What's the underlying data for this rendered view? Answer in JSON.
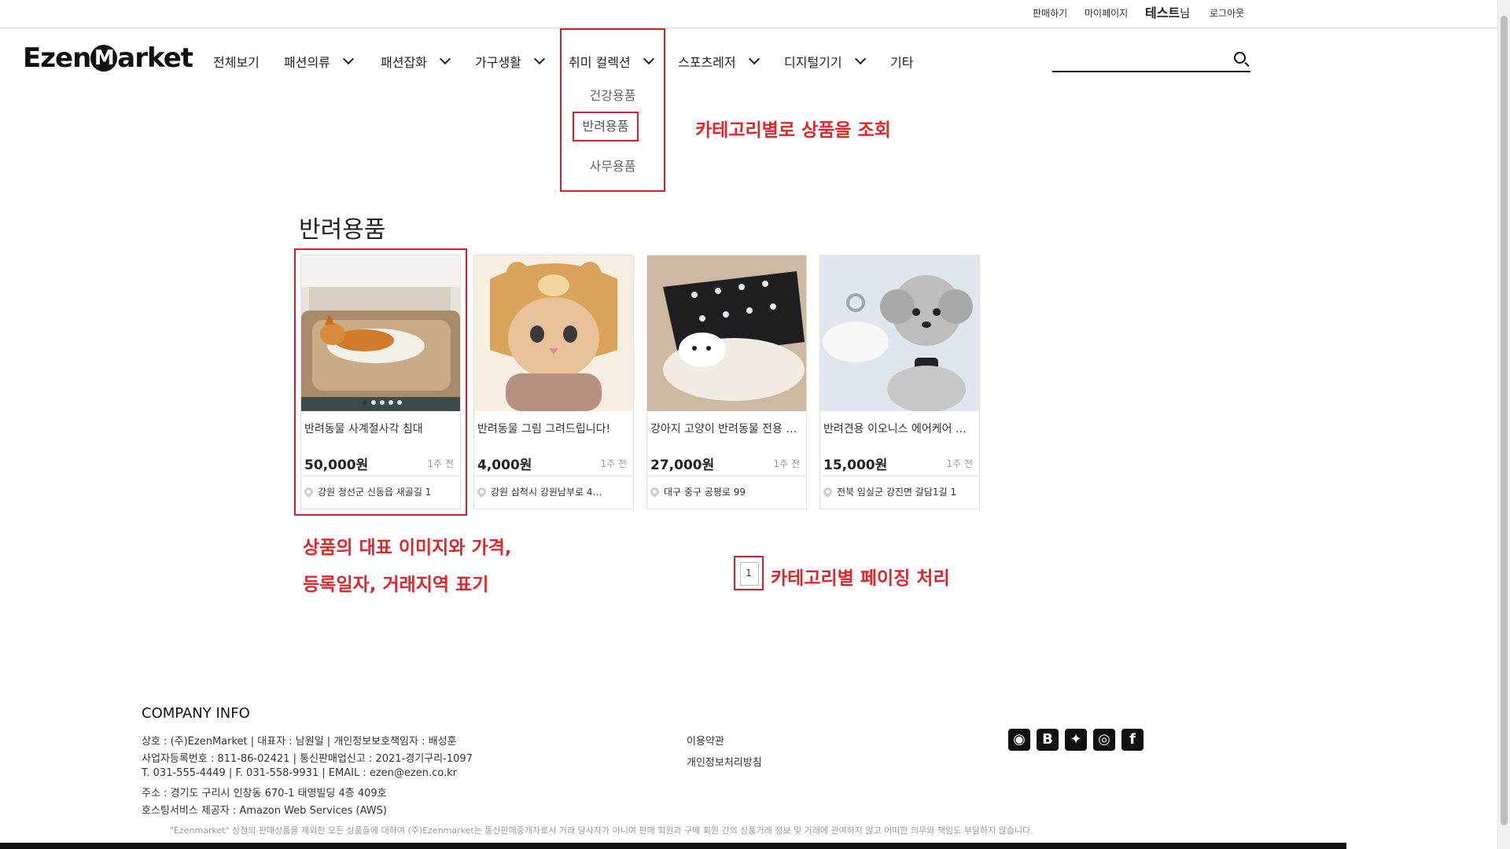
{
  "topbar": {
    "sell": "판매하기",
    "mypage": "마이페이지",
    "user_name": "테스트",
    "user_suffix": "님",
    "logout": "로그아웃"
  },
  "header": {
    "logo_left": "Ezen",
    "logo_mark": "M",
    "logo_right": "arket",
    "nav": {
      "all": "전체보기",
      "fashion_clothing": "패션의류",
      "fashion_goods": "패션잡화",
      "furniture": "가구생활",
      "hobby": "취미 컬렉션",
      "sports": "스포츠레저",
      "digital": "디지털기기",
      "etc": "기타"
    },
    "search_placeholder": ""
  },
  "dropdown": {
    "items": [
      "건강용품",
      "반려용품",
      "사무용품"
    ],
    "active": "반려용품"
  },
  "annotations": {
    "category_view": "카테고리별로 상품을 조회",
    "card_info_line1": "상품의 대표 이미지와 가격,",
    "card_info_line2": "등록일자, 거래지역 표기",
    "paging": "카테고리별 페이징 처리"
  },
  "category_title": "반려용품",
  "products": [
    {
      "title": "반려동물 사계절사각 침대",
      "price": "50,000원",
      "ago": "1주 전",
      "location": "강원 정선군 신동읍 새골길 1",
      "image": "dog-on-bed"
    },
    {
      "title": "반려동물 그림 그려드립니다!",
      "price": "4,000원",
      "ago": "1주 전",
      "location": "강원 삼척시 강원남부로 4…",
      "image": "cat-drawing"
    },
    {
      "title": "강아지 고양이 반려동물 전용 …",
      "price": "27,000원",
      "ago": "1주 전",
      "location": "대구 중구 공평로 99",
      "image": "pet-blanket"
    },
    {
      "title": "반려견용 이오니스 에어케어 …",
      "price": "15,000원",
      "ago": "1주 전",
      "location": "전북 임실군 강진면 갈담1길 1",
      "image": "poodle-device"
    }
  ],
  "pagination": {
    "current": "1"
  },
  "footer": {
    "company_title": "COMPANY INFO",
    "line1": "상호 : (주)EzenMarket   |   대표자 : 남원일   |   개인정보보호책임자 : 배성훈",
    "line2": "사업자등록번호 : 811-86-02421   |   통신판매업신고 : 2021-경기구리-1097",
    "line3": "T. 031-555-4449   |   F. 031-558-9931   |   EMAIL : ezen@ezen.co.kr",
    "line4": "주소 : 경기도 구리시 인창동 670-1 태영빌딩 4층 409호",
    "line5": "호스팅서비스 제공자 : Amazon Web Services (AWS)",
    "terms": "이용약관",
    "privacy": "개인정보처리방침",
    "disclaimer": "\"Ezenmarket\" 상점의 판매상품을 제외한 모든 상품들에 대하여 (주)Ezenmarket는 통신판매중개자로서 거래 당사자가 아니며 판매 회원과 구매 회원 간의 상품거래 정보 및 거래에 관여하지 않고 어떠한 의무와 책임도 부담하지 않습니다."
  },
  "social_icons": [
    "github-icon",
    "blogger-icon",
    "twitter-icon",
    "instagram-icon",
    "facebook-icon"
  ]
}
